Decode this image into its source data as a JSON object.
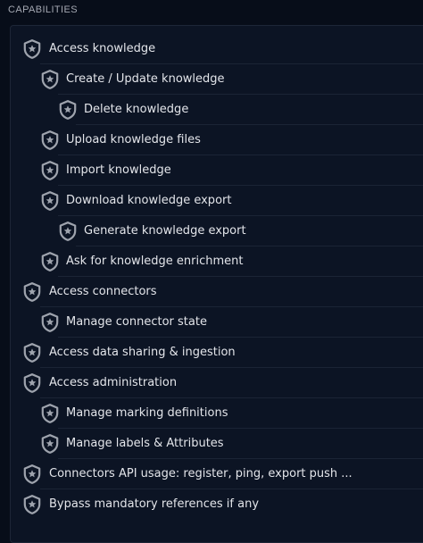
{
  "section": {
    "title": "CAPABILITIES"
  },
  "capabilities": [
    {
      "label": "Access knowledge",
      "level": 0
    },
    {
      "label": "Create / Update knowledge",
      "level": 1
    },
    {
      "label": "Delete knowledge",
      "level": 2
    },
    {
      "label": "Upload knowledge files",
      "level": 1
    },
    {
      "label": "Import knowledge",
      "level": 1
    },
    {
      "label": "Download knowledge export",
      "level": 1
    },
    {
      "label": "Generate knowledge export",
      "level": 2
    },
    {
      "label": "Ask for knowledge enrichment",
      "level": 1
    },
    {
      "label": "Access connectors",
      "level": 0
    },
    {
      "label": "Manage connector state",
      "level": 1
    },
    {
      "label": "Access data sharing & ingestion",
      "level": 0
    },
    {
      "label": "Access administration",
      "level": 0
    },
    {
      "label": "Manage marking definitions",
      "level": 1
    },
    {
      "label": "Manage labels & Attributes",
      "level": 1
    },
    {
      "label": "Connectors API usage: register, ping, export push ...",
      "level": 0
    },
    {
      "label": "Bypass mandatory references if any",
      "level": 0
    }
  ],
  "icon": {
    "name": "shield-star-icon",
    "color": "#9ea3ad"
  },
  "colors": {
    "background": "#070d19",
    "panel": "#0c1424",
    "divider": "#1b2435",
    "text": "#e3e5ea"
  }
}
